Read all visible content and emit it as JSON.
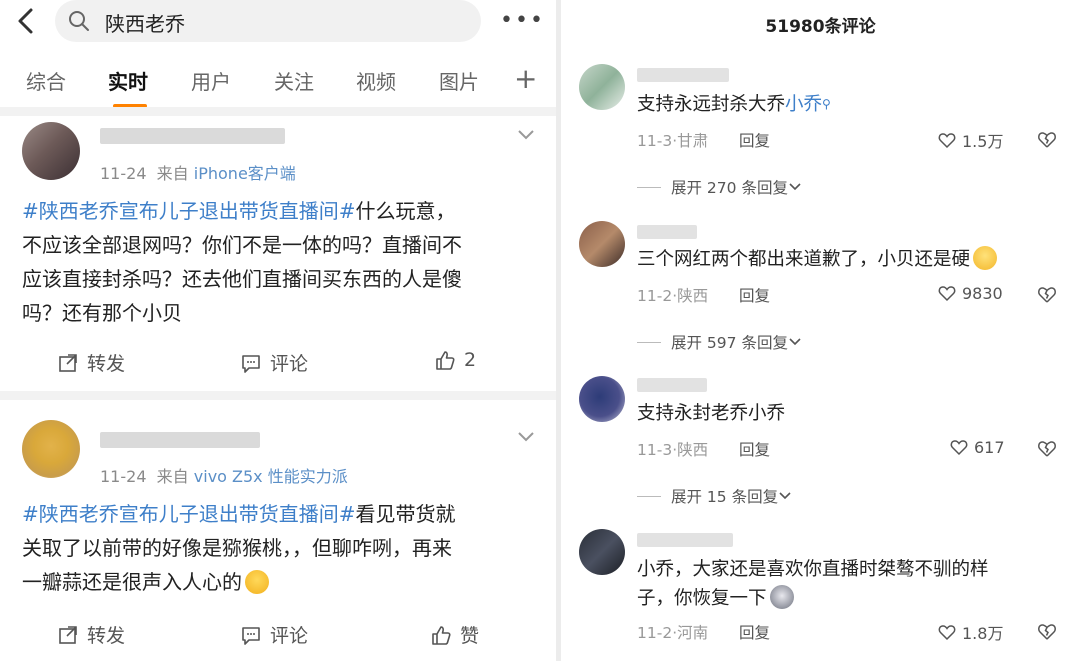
{
  "search": {
    "query": "陕西老乔"
  },
  "tabs": [
    "综合",
    "实时",
    "用户",
    "关注",
    "视频",
    "图片"
  ],
  "posts": [
    {
      "date": "11-24",
      "source_prefix": "来自",
      "source": "iPhone客户端",
      "hashtag": "#陕西老乔宣布儿子退出带货直播间#",
      "lines": [
        "什么玩意，",
        "不应该全部退网吗？你们不是一体的吗？直播间不",
        "应该直接封杀吗？还去他们直播间买东西的人是傻",
        "吗？还有那个小贝"
      ],
      "repost": "转发",
      "comment": "评论",
      "likes": "2"
    },
    {
      "date": "11-24",
      "source_prefix": "来自",
      "source": "vivo Z5x 性能实力派",
      "hashtag": "#陕西老乔宣布儿子退出带货直播间#",
      "lines": [
        "看见带货就",
        "关取了以前带的好像是猕猴桃，，但聊咋咧，再来",
        "一瓣蒜还是很声入人心的"
      ],
      "repost": "转发",
      "comment": "评论",
      "likes": "赞"
    }
  ],
  "comments_panel": {
    "title": "51980条评论",
    "comments": [
      {
        "text": "支持永远封杀大乔",
        "link": "小乔",
        "date": "11-3",
        "region": "甘肃",
        "reply": "回复",
        "likes": "1.5万",
        "expand": "展开 270 条回复"
      },
      {
        "text": "三个网红两个都出来道歉了，小贝还是硬",
        "date": "11-2",
        "region": "陕西",
        "reply": "回复",
        "likes": "9830",
        "expand": "展开 597 条回复"
      },
      {
        "text": "支持永封老乔小乔",
        "date": "11-3",
        "region": "陕西",
        "reply": "回复",
        "likes": "617",
        "expand": "展开 15 条回复"
      },
      {
        "line1": "小乔，大家还是喜欢你直播时桀骜不驯的样",
        "line2": "子，你恢复一下",
        "date": "11-2",
        "region": "河南",
        "reply": "回复",
        "likes": "1.8万"
      }
    ]
  },
  "colors": {
    "accent": "#ff8200",
    "link": "#3e7fc9"
  }
}
